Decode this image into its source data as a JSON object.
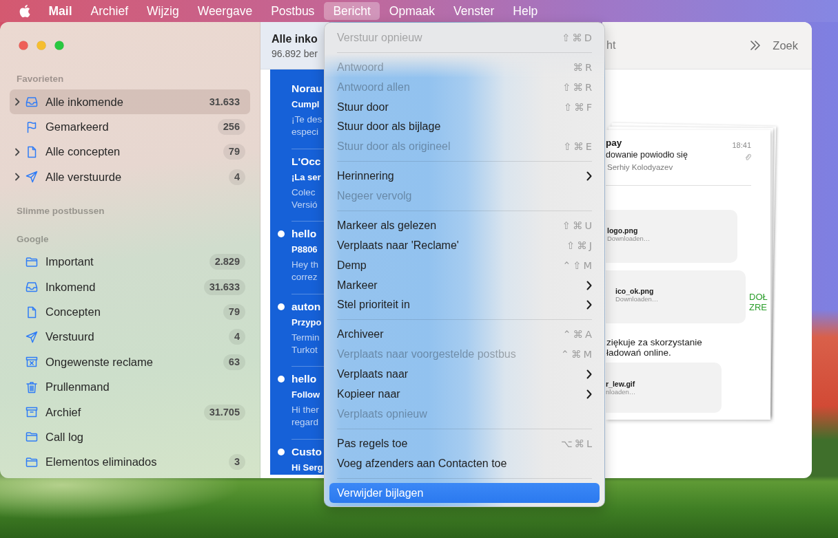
{
  "menu_bar": {
    "items": [
      {
        "label": "Mail",
        "kind": "app",
        "selected": false
      },
      {
        "label": "Archief",
        "kind": "menu",
        "selected": false
      },
      {
        "label": "Wijzig",
        "kind": "menu",
        "selected": false
      },
      {
        "label": "Weergave",
        "kind": "menu",
        "selected": false
      },
      {
        "label": "Postbus",
        "kind": "menu",
        "selected": false
      },
      {
        "label": "Bericht",
        "kind": "menu",
        "selected": true
      },
      {
        "label": "Opmaak",
        "kind": "menu",
        "selected": false
      },
      {
        "label": "Venster",
        "kind": "menu",
        "selected": false
      },
      {
        "label": "Help",
        "kind": "menu",
        "selected": false
      }
    ]
  },
  "sidebar": {
    "sections": [
      {
        "title": "Favorieten",
        "items": [
          {
            "label": "Alle inkomende",
            "kind": "inbox",
            "count": "31.633",
            "expanded": false,
            "selected": true
          },
          {
            "label": "Gemarkeerd",
            "kind": "flagged",
            "count": "256",
            "selected": false
          },
          {
            "label": "Alle concepten",
            "kind": "drafts",
            "count": "79",
            "expanded": false,
            "selected": false
          },
          {
            "label": "Alle verstuurde",
            "kind": "sent",
            "count": "4",
            "expanded": false,
            "selected": false
          }
        ]
      },
      {
        "title": "Slimme postbussen"
      },
      {
        "title": "Google",
        "items": [
          {
            "label": "Important",
            "kind": "folder",
            "count": "2.829",
            "selected": false
          },
          {
            "label": "Inkomend",
            "kind": "inbox",
            "count": "31.633",
            "selected": false
          },
          {
            "label": "Concepten",
            "kind": "drafts",
            "count": "79",
            "selected": false
          },
          {
            "label": "Verstuurd",
            "kind": "sent",
            "count": "4",
            "selected": false
          },
          {
            "label": "Ongewenste reclame",
            "kind": "junk",
            "count": "63",
            "selected": false
          },
          {
            "label": "Prullenmand",
            "kind": "trash",
            "selected": false
          },
          {
            "label": "Archief",
            "kind": "archive",
            "count": "31.705",
            "selected": false
          },
          {
            "label": "Call log",
            "kind": "folder",
            "selected": false
          },
          {
            "label": "Elementos eliminados",
            "kind": "folder",
            "count": "3",
            "selected": false
          }
        ]
      }
    ]
  },
  "message_list": {
    "title": "Alle inko",
    "subtitle": "96.892 ber",
    "messages": [
      {
        "sender": "Norau",
        "subject": "Cumpl",
        "preview": [
          "¡Te des",
          "especi"
        ],
        "unread": false,
        "selected": true
      },
      {
        "sender": "L'Occ",
        "subject": "¡La ser",
        "preview": [
          "Colec",
          "Versió"
        ],
        "unread": false,
        "selected": true
      },
      {
        "sender": "hello",
        "subject": "P8806",
        "preview": [
          "Hey th",
          "correz"
        ],
        "unread": true,
        "selected": true
      },
      {
        "sender": "auton",
        "subject": "Przypo",
        "preview": [
          "Termin",
          "Turkot"
        ],
        "unread": true,
        "selected": true
      },
      {
        "sender": "hello",
        "subject": "Follow",
        "preview": [
          "Hi ther",
          "regard"
        ],
        "unread": true,
        "selected": true
      },
      {
        "sender": "Custo",
        "subject": "Hi Serg",
        "unread": true,
        "selected": true
      }
    ]
  },
  "reading_pane": {
    "toolbar": {
      "text": "ht",
      "search": "Zoek"
    },
    "document": {
      "sender": "pay",
      "time": "18:41",
      "subject": "dowanie powiodło się",
      "recipient": "Serhiy Kolodyazev",
      "blocks": [
        {
          "kind": "attachment",
          "name": "logo.png",
          "status": "Downloaden…"
        },
        {
          "kind": "attachment",
          "name": "ico_ok.png",
          "status": "Downloaden…",
          "side_text": [
            "DOŁ",
            "ZRE"
          ]
        },
        {
          "kind": "text",
          "lines": [
            "ziękuje za skorzystanie",
            "ładowań online."
          ]
        },
        {
          "kind": "attachment",
          "name": "r_lew.gif",
          "status": "nloaden…"
        }
      ]
    }
  },
  "menu": {
    "sections": [
      {
        "items": [
          {
            "label": "Verstuur opnieuw",
            "shortcut": "⇧⌘D",
            "disabled": true,
            "submenu": false,
            "selected": false
          }
        ]
      },
      {
        "items": [
          {
            "label": "Antwoord",
            "shortcut": "⌘R",
            "disabled": true,
            "submenu": false,
            "selected": false
          },
          {
            "label": "Antwoord allen",
            "shortcut": "⇧⌘R",
            "disabled": true,
            "submenu": false,
            "selected": false
          },
          {
            "label": "Stuur door",
            "shortcut": "⇧⌘F",
            "disabled": false,
            "submenu": false,
            "selected": false
          },
          {
            "label": "Stuur door als bijlage",
            "disabled": false,
            "submenu": false,
            "selected": false
          },
          {
            "label": "Stuur door als origineel",
            "shortcut": "⇧⌘E",
            "disabled": true,
            "submenu": false,
            "selected": false
          }
        ]
      },
      {
        "items": [
          {
            "label": "Herinnering",
            "disabled": false,
            "submenu": true,
            "selected": false
          },
          {
            "label": "Negeer vervolg",
            "disabled": true,
            "submenu": false,
            "selected": false
          }
        ]
      },
      {
        "items": [
          {
            "label": "Markeer als gelezen",
            "shortcut": "⇧⌘U",
            "disabled": false,
            "submenu": false,
            "selected": false
          },
          {
            "label": "Verplaats naar 'Reclame'",
            "shortcut": "⇧⌘J",
            "disabled": false,
            "submenu": false,
            "selected": false
          },
          {
            "label": "Demp",
            "shortcut": "⌃⇧M",
            "disabled": false,
            "submenu": false,
            "selected": false
          },
          {
            "label": "Markeer",
            "disabled": false,
            "submenu": true,
            "selected": false
          },
          {
            "label": "Stel prioriteit in",
            "disabled": false,
            "submenu": true,
            "selected": false
          }
        ]
      },
      {
        "items": [
          {
            "label": "Archiveer",
            "shortcut": "⌃⌘A",
            "disabled": false,
            "submenu": false,
            "selected": false
          },
          {
            "label": "Verplaats naar voorgestelde postbus",
            "shortcut": "⌃⌘M",
            "disabled": true,
            "submenu": false,
            "selected": false
          },
          {
            "label": "Verplaats naar",
            "disabled": false,
            "submenu": true,
            "selected": false
          },
          {
            "label": "Kopieer naar",
            "disabled": false,
            "submenu": true,
            "selected": false
          },
          {
            "label": "Verplaats opnieuw",
            "disabled": true,
            "submenu": false,
            "selected": false
          }
        ]
      },
      {
        "items": [
          {
            "label": "Pas regels toe",
            "shortcut": "⌥⌘L",
            "disabled": false,
            "submenu": false,
            "selected": false
          },
          {
            "label": "Voeg afzenders aan Contacten toe",
            "disabled": false,
            "submenu": false,
            "selected": false
          }
        ]
      },
      {
        "items": [
          {
            "label": "Verwijder bijlagen",
            "disabled": false,
            "submenu": false,
            "selected": true
          }
        ]
      }
    ]
  }
}
